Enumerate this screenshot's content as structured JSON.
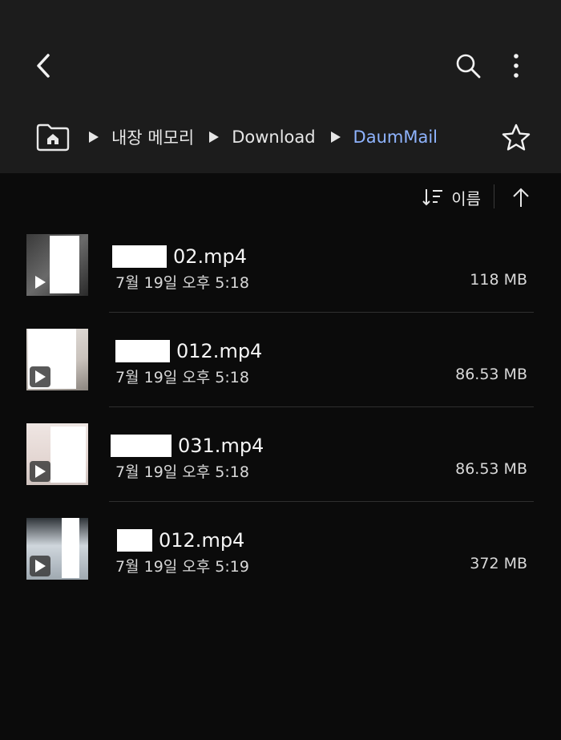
{
  "breadcrumbs": [
    {
      "label": "내장 메모리"
    },
    {
      "label": "Download"
    },
    {
      "label": "DaumMail"
    }
  ],
  "sort": {
    "label": "이름"
  },
  "files": [
    {
      "name": "02.mp4",
      "date": "7월 19일 오후 5:18",
      "size": "118 MB"
    },
    {
      "name": "012.mp4",
      "date": "7월 19일 오후 5:18",
      "size": "86.53 MB"
    },
    {
      "name": "031.mp4",
      "date": "7월 19일 오후 5:18",
      "size": "86.53 MB"
    },
    {
      "name": "012.mp4",
      "date": "7월 19일 오후 5:19",
      "size": "372 MB"
    }
  ]
}
